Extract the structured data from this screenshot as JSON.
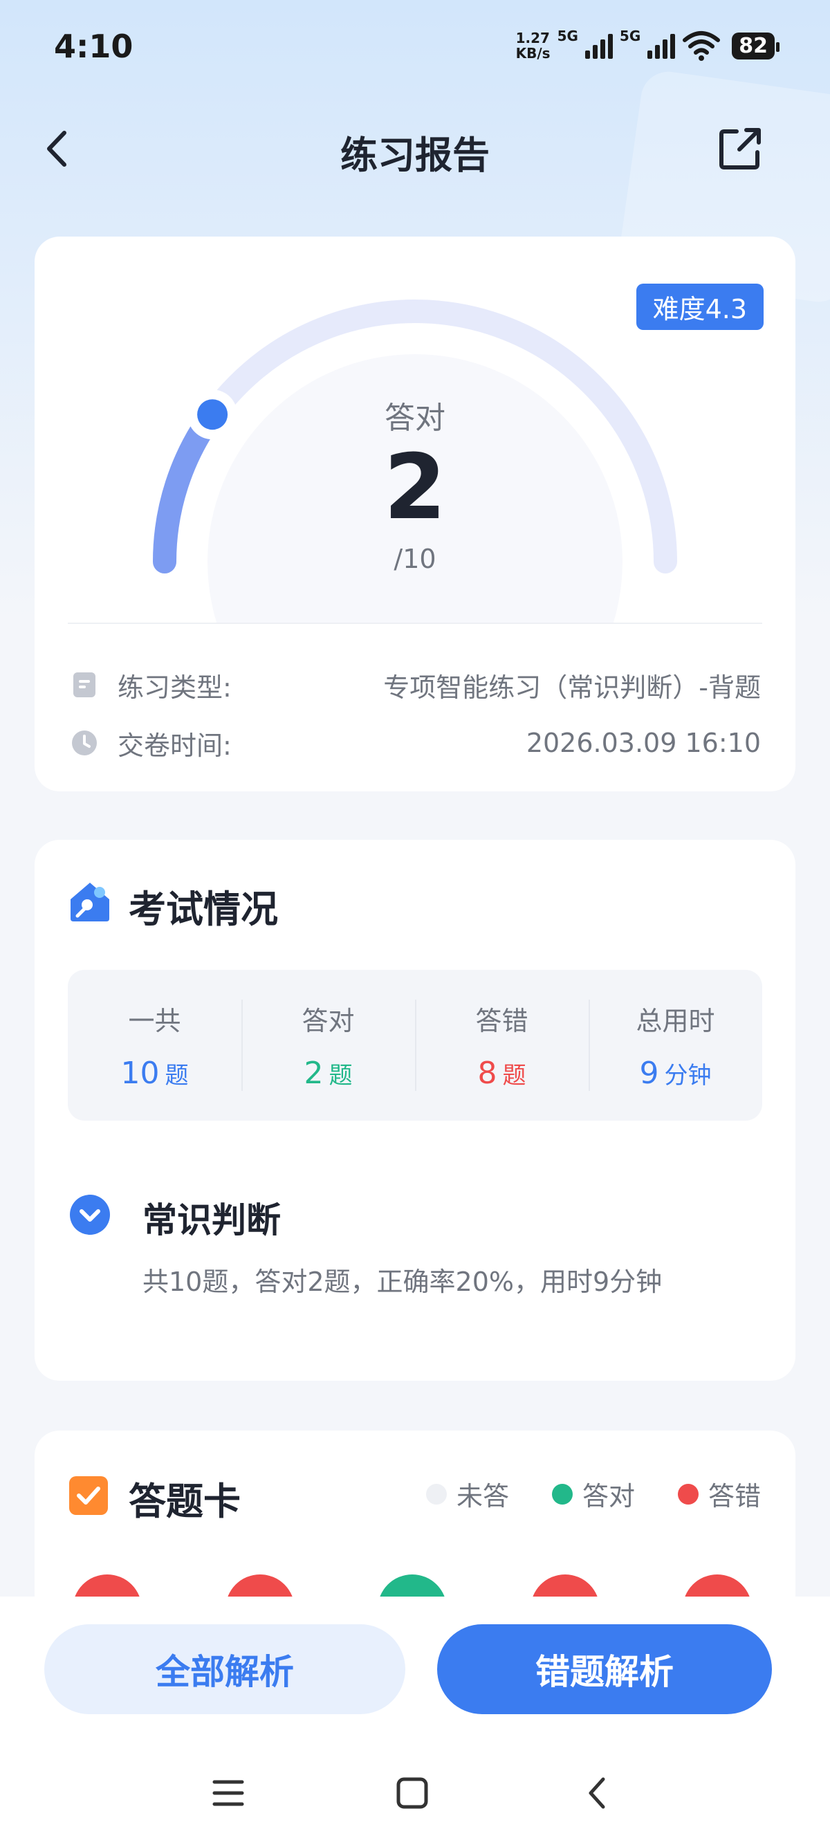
{
  "status_bar": {
    "time": "4:10",
    "speed_value": "1.27",
    "speed_unit": "KB/s",
    "network_1": "5G",
    "network_2": "5G",
    "battery": "82"
  },
  "header": {
    "title": "练习报告"
  },
  "result": {
    "difficulty": "难度4.3",
    "correct_label": "答对",
    "correct_count": "2",
    "total": "/10",
    "correct_fraction": 0.2,
    "practice_type_label": "练习类型:",
    "practice_type_value": "专项智能练习（常识判断）-背题",
    "submit_time_label": "交卷时间:",
    "submit_time_value": "2026.03.09 16:10"
  },
  "exam": {
    "title": "考试情况",
    "stats": [
      {
        "label": "一共",
        "value": "10",
        "unit": "题"
      },
      {
        "label": "答对",
        "value": "2",
        "unit": "题"
      },
      {
        "label": "答错",
        "value": "8",
        "unit": "题"
      },
      {
        "label": "总用时",
        "value": "9",
        "unit": "分钟"
      }
    ],
    "category_title": "常识判断",
    "category_summary": "共10题，答对2题，正确率20%，用时9分钟"
  },
  "answer_card": {
    "title": "答题卡",
    "legend": {
      "unanswered": "未答",
      "correct": "答对",
      "wrong": "答错"
    },
    "visible_results": [
      "wrong",
      "wrong",
      "correct",
      "wrong",
      "wrong"
    ]
  },
  "actions": {
    "all_analysis": "全部解析",
    "wrong_analysis": "错题解析"
  },
  "colors": {
    "accent": "#3b7cf0",
    "correct": "#22b88a",
    "wrong": "#ef4b4b",
    "unanswered": "#eef0f4",
    "orange": "#ff8a30"
  }
}
